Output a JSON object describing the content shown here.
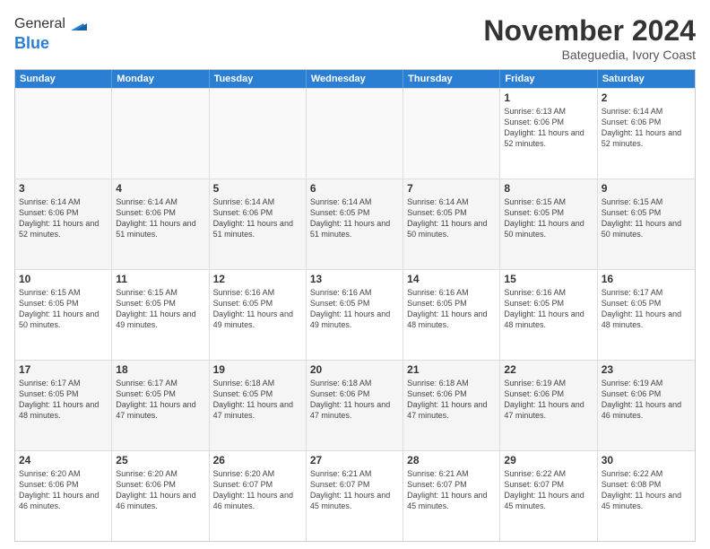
{
  "header": {
    "logo_general": "General",
    "logo_blue": "Blue",
    "month": "November 2024",
    "location": "Bateguedia, Ivory Coast"
  },
  "calendar": {
    "days_of_week": [
      "Sunday",
      "Monday",
      "Tuesday",
      "Wednesday",
      "Thursday",
      "Friday",
      "Saturday"
    ],
    "rows": [
      [
        {
          "day": "",
          "empty": true
        },
        {
          "day": "",
          "empty": true
        },
        {
          "day": "",
          "empty": true
        },
        {
          "day": "",
          "empty": true
        },
        {
          "day": "",
          "empty": true
        },
        {
          "day": "1",
          "sunrise": "Sunrise: 6:13 AM",
          "sunset": "Sunset: 6:06 PM",
          "daylight": "Daylight: 11 hours and 52 minutes."
        },
        {
          "day": "2",
          "sunrise": "Sunrise: 6:14 AM",
          "sunset": "Sunset: 6:06 PM",
          "daylight": "Daylight: 11 hours and 52 minutes."
        }
      ],
      [
        {
          "day": "3",
          "sunrise": "Sunrise: 6:14 AM",
          "sunset": "Sunset: 6:06 PM",
          "daylight": "Daylight: 11 hours and 52 minutes."
        },
        {
          "day": "4",
          "sunrise": "Sunrise: 6:14 AM",
          "sunset": "Sunset: 6:06 PM",
          "daylight": "Daylight: 11 hours and 51 minutes."
        },
        {
          "day": "5",
          "sunrise": "Sunrise: 6:14 AM",
          "sunset": "Sunset: 6:06 PM",
          "daylight": "Daylight: 11 hours and 51 minutes."
        },
        {
          "day": "6",
          "sunrise": "Sunrise: 6:14 AM",
          "sunset": "Sunset: 6:05 PM",
          "daylight": "Daylight: 11 hours and 51 minutes."
        },
        {
          "day": "7",
          "sunrise": "Sunrise: 6:14 AM",
          "sunset": "Sunset: 6:05 PM",
          "daylight": "Daylight: 11 hours and 50 minutes."
        },
        {
          "day": "8",
          "sunrise": "Sunrise: 6:15 AM",
          "sunset": "Sunset: 6:05 PM",
          "daylight": "Daylight: 11 hours and 50 minutes."
        },
        {
          "day": "9",
          "sunrise": "Sunrise: 6:15 AM",
          "sunset": "Sunset: 6:05 PM",
          "daylight": "Daylight: 11 hours and 50 minutes."
        }
      ],
      [
        {
          "day": "10",
          "sunrise": "Sunrise: 6:15 AM",
          "sunset": "Sunset: 6:05 PM",
          "daylight": "Daylight: 11 hours and 50 minutes."
        },
        {
          "day": "11",
          "sunrise": "Sunrise: 6:15 AM",
          "sunset": "Sunset: 6:05 PM",
          "daylight": "Daylight: 11 hours and 49 minutes."
        },
        {
          "day": "12",
          "sunrise": "Sunrise: 6:16 AM",
          "sunset": "Sunset: 6:05 PM",
          "daylight": "Daylight: 11 hours and 49 minutes."
        },
        {
          "day": "13",
          "sunrise": "Sunrise: 6:16 AM",
          "sunset": "Sunset: 6:05 PM",
          "daylight": "Daylight: 11 hours and 49 minutes."
        },
        {
          "day": "14",
          "sunrise": "Sunrise: 6:16 AM",
          "sunset": "Sunset: 6:05 PM",
          "daylight": "Daylight: 11 hours and 48 minutes."
        },
        {
          "day": "15",
          "sunrise": "Sunrise: 6:16 AM",
          "sunset": "Sunset: 6:05 PM",
          "daylight": "Daylight: 11 hours and 48 minutes."
        },
        {
          "day": "16",
          "sunrise": "Sunrise: 6:17 AM",
          "sunset": "Sunset: 6:05 PM",
          "daylight": "Daylight: 11 hours and 48 minutes."
        }
      ],
      [
        {
          "day": "17",
          "sunrise": "Sunrise: 6:17 AM",
          "sunset": "Sunset: 6:05 PM",
          "daylight": "Daylight: 11 hours and 48 minutes."
        },
        {
          "day": "18",
          "sunrise": "Sunrise: 6:17 AM",
          "sunset": "Sunset: 6:05 PM",
          "daylight": "Daylight: 11 hours and 47 minutes."
        },
        {
          "day": "19",
          "sunrise": "Sunrise: 6:18 AM",
          "sunset": "Sunset: 6:05 PM",
          "daylight": "Daylight: 11 hours and 47 minutes."
        },
        {
          "day": "20",
          "sunrise": "Sunrise: 6:18 AM",
          "sunset": "Sunset: 6:06 PM",
          "daylight": "Daylight: 11 hours and 47 minutes."
        },
        {
          "day": "21",
          "sunrise": "Sunrise: 6:18 AM",
          "sunset": "Sunset: 6:06 PM",
          "daylight": "Daylight: 11 hours and 47 minutes."
        },
        {
          "day": "22",
          "sunrise": "Sunrise: 6:19 AM",
          "sunset": "Sunset: 6:06 PM",
          "daylight": "Daylight: 11 hours and 47 minutes."
        },
        {
          "day": "23",
          "sunrise": "Sunrise: 6:19 AM",
          "sunset": "Sunset: 6:06 PM",
          "daylight": "Daylight: 11 hours and 46 minutes."
        }
      ],
      [
        {
          "day": "24",
          "sunrise": "Sunrise: 6:20 AM",
          "sunset": "Sunset: 6:06 PM",
          "daylight": "Daylight: 11 hours and 46 minutes."
        },
        {
          "day": "25",
          "sunrise": "Sunrise: 6:20 AM",
          "sunset": "Sunset: 6:06 PM",
          "daylight": "Daylight: 11 hours and 46 minutes."
        },
        {
          "day": "26",
          "sunrise": "Sunrise: 6:20 AM",
          "sunset": "Sunset: 6:07 PM",
          "daylight": "Daylight: 11 hours and 46 minutes."
        },
        {
          "day": "27",
          "sunrise": "Sunrise: 6:21 AM",
          "sunset": "Sunset: 6:07 PM",
          "daylight": "Daylight: 11 hours and 45 minutes."
        },
        {
          "day": "28",
          "sunrise": "Sunrise: 6:21 AM",
          "sunset": "Sunset: 6:07 PM",
          "daylight": "Daylight: 11 hours and 45 minutes."
        },
        {
          "day": "29",
          "sunrise": "Sunrise: 6:22 AM",
          "sunset": "Sunset: 6:07 PM",
          "daylight": "Daylight: 11 hours and 45 minutes."
        },
        {
          "day": "30",
          "sunrise": "Sunrise: 6:22 AM",
          "sunset": "Sunset: 6:08 PM",
          "daylight": "Daylight: 11 hours and 45 minutes."
        }
      ]
    ]
  }
}
